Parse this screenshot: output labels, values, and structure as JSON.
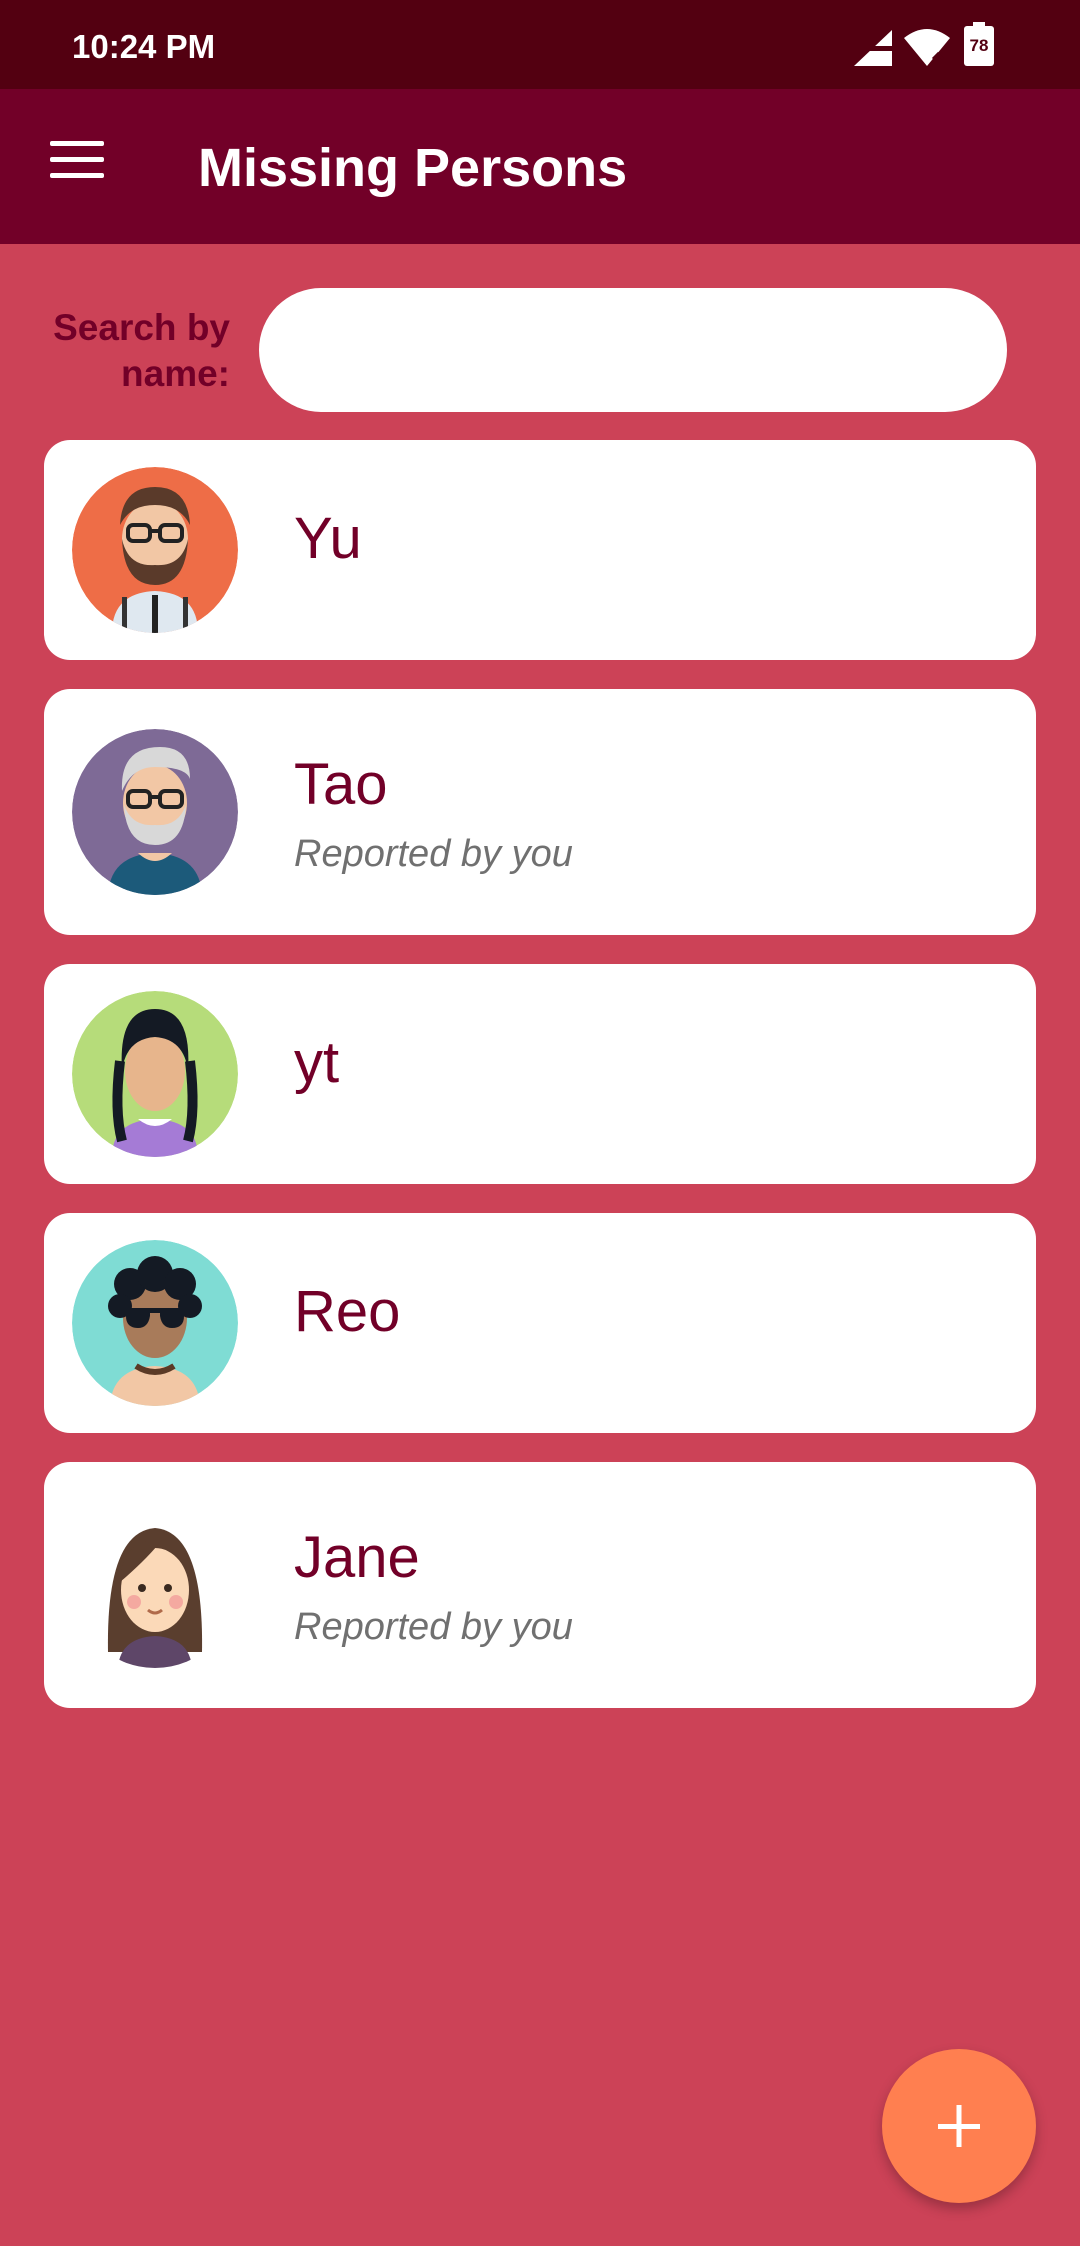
{
  "status_bar": {
    "time": "10:24 PM",
    "battery": "78",
    "icons": [
      "signal-icon",
      "wifi-icon",
      "battery-icon"
    ]
  },
  "app_bar": {
    "title": "Missing Persons",
    "menu_icon": "menu-icon"
  },
  "search": {
    "label": "Search by name:",
    "placeholder": "",
    "value": ""
  },
  "persons": [
    {
      "name": "Yu",
      "note": "",
      "avatar": "bearded-man-glasses-avatar"
    },
    {
      "name": "Tao",
      "note": "Reported by you",
      "avatar": "old-man-glasses-avatar"
    },
    {
      "name": "yt",
      "note": "",
      "avatar": "girl-braids-avatar"
    },
    {
      "name": "Reo",
      "note": "",
      "avatar": "curly-hair-sunglasses-avatar"
    },
    {
      "name": "Jane",
      "note": "Reported by you",
      "avatar": "woman-brown-hair-avatar"
    }
  ],
  "fab": {
    "icon": "plus-icon"
  },
  "colors": {
    "background": "#cc4257",
    "status_bar": "#530011",
    "app_bar": "#720028",
    "name_text": "#720028",
    "fab": "#ff7f50"
  }
}
